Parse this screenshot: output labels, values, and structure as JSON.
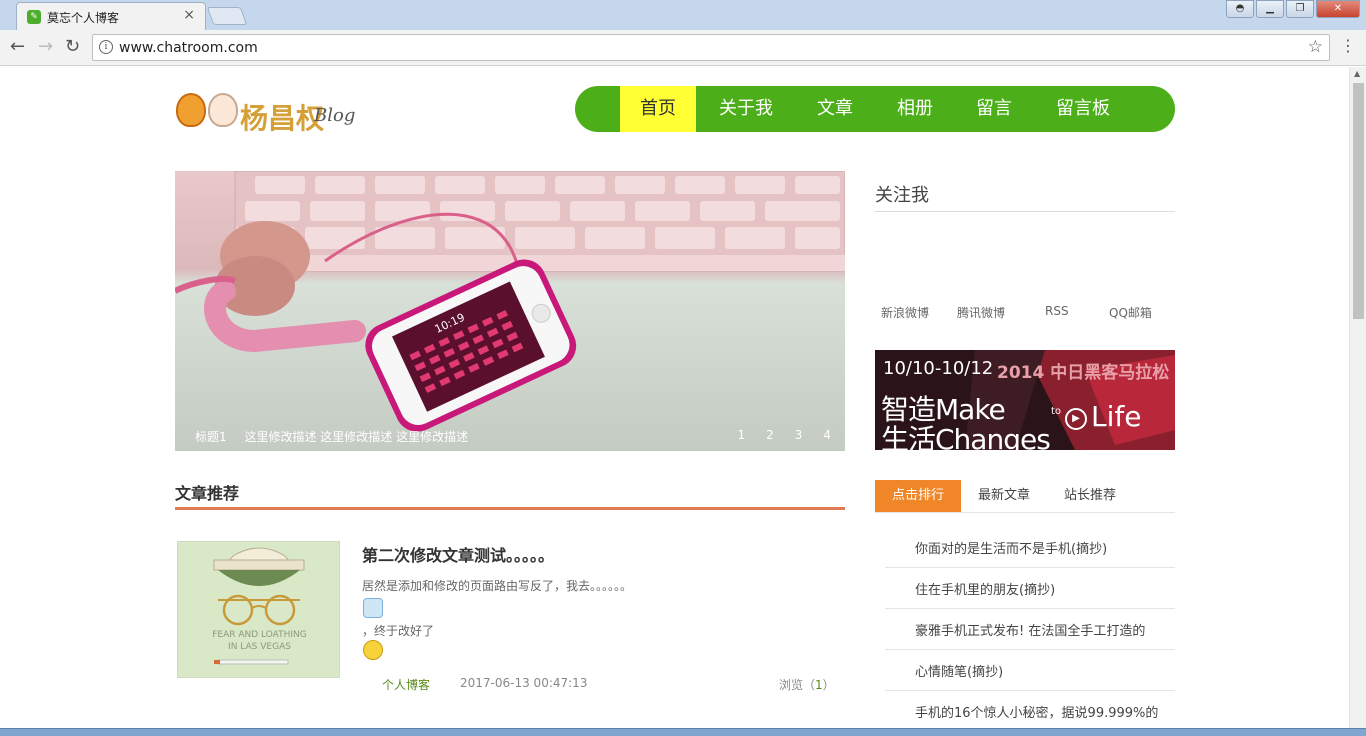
{
  "browser": {
    "tab_title": "莫忘个人博客",
    "url": "www.chatroom.com"
  },
  "site": {
    "logo_text": "杨昌权",
    "logo_blog": "Blog",
    "nav": [
      "首页",
      "关于我",
      "文章",
      "相册",
      "留言",
      "留言板"
    ]
  },
  "banner": {
    "title": "标题1",
    "description": "这里修改描述 这里修改描述 这里修改描述",
    "dots": [
      "1",
      "2",
      "3",
      "4"
    ],
    "phone_time": "10:19"
  },
  "articles_section": {
    "title": "文章推荐",
    "items": [
      {
        "title": "第二次修改文章测试。。。。。",
        "desc": "居然是添加和修改的页面路由写反了，我去。。。。。。",
        "desc2": "，终于改好了",
        "thumb_line1": "FEAR AND LOATHING",
        "thumb_line2": "IN LAS VEGAS",
        "category": "个人博客",
        "date": "2017-06-13 00:47:13",
        "views_label": "浏览（",
        "views": "1",
        "views_close": "）"
      }
    ]
  },
  "sidebar": {
    "follow_title": "关注我",
    "social": [
      "新浪微博",
      "腾讯微博",
      "RSS",
      "QQ邮箱"
    ],
    "ad": {
      "dates": "10/10-10/12",
      "title": "2014 中日黑客马拉松",
      "line1": "智造Make",
      "line2": "生活Changes",
      "to": "to",
      "life": "Life"
    },
    "tabs": [
      "点击排行",
      "最新文章",
      "站长推荐"
    ],
    "rank": [
      "你面对的是生活而不是手机(摘抄)",
      "住在手机里的朋友(摘抄)",
      "豪雅手机正式发布! 在法国全手工打造的",
      "心情随笔(摘抄)",
      "手机的16个惊人小秘密，据说99.999%的"
    ]
  },
  "colors": {
    "nav_green": "#4cae18",
    "nav_active": "#ffff33",
    "section_line": "#e07b53",
    "tab_active": "#f08628"
  }
}
